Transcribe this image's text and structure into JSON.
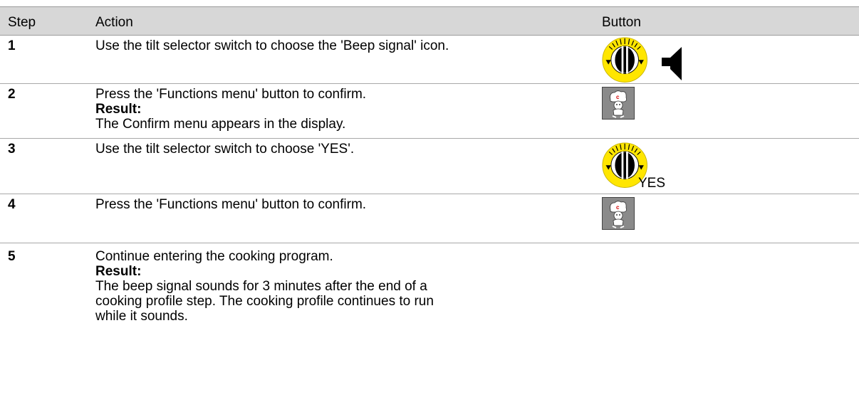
{
  "headers": {
    "step": "Step",
    "action": "Action",
    "button": "Button"
  },
  "rows": [
    {
      "step": "1",
      "action": "Use the tilt selector switch to choose the 'Beep signal' icon.",
      "button_icons": [
        "tilt-selector-icon",
        "speaker-icon"
      ]
    },
    {
      "step": "2",
      "action": "Press the 'Functions menu' button to confirm.",
      "result_label": "Result:",
      "result_text": "The Confirm menu appears in the display.",
      "button_icons": [
        "functions-menu-chef-icon"
      ]
    },
    {
      "step": "3",
      "action": "Use the tilt selector switch to choose 'YES'.",
      "button_icons": [
        "tilt-selector-icon"
      ],
      "button_text": "YES"
    },
    {
      "step": "4",
      "action": "Press the 'Functions menu' button to confirm.",
      "button_icons": [
        "functions-menu-chef-icon"
      ]
    },
    {
      "step": "5",
      "action": "Continue entering the cooking program.",
      "result_label": "Result:",
      "result_lines": [
        "The beep signal sounds for 3 minutes after the end of a",
        "cooking profile step. The cooking profile continues to run",
        "while it sounds."
      ]
    }
  ],
  "colors": {
    "header_bg": "#d7d7d7",
    "dial_yellow": "#ffe600",
    "chef_bg": "#8a8a8a"
  }
}
